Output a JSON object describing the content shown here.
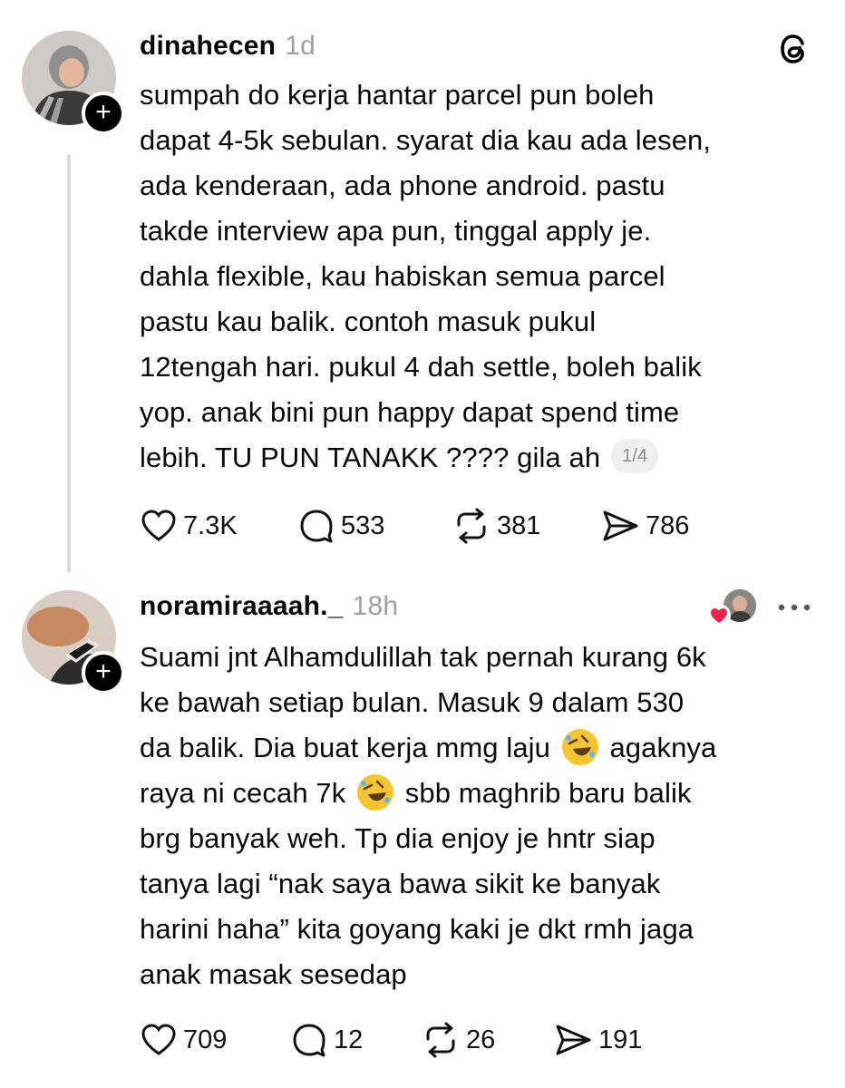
{
  "app": {
    "logo_icon": "threads-logo-icon"
  },
  "posts": [
    {
      "username": "dinahecen",
      "time": "1d",
      "lines": [
        "sumpah do kerja hantar parcel pun boleh",
        "dapat 4-5k sebulan. syarat dia kau ada lesen,",
        "ada kenderaan, ada phone android. pastu",
        "takde interview apa pun, tinggal apply je.",
        "dahla flexible, kau habiskan semua parcel",
        "pastu kau balik. contoh masuk pukul",
        "12tengah hari. pukul 4 dah settle, boleh balik",
        "yop. anak bini pun happy dapat spend time",
        "lebih. TU PUN TANAKK ???? gila ah"
      ],
      "page_indicator": "1/4",
      "likes": "7.3K",
      "replies": "533",
      "reposts": "381",
      "shares": "786"
    },
    {
      "username": "noramiraaaah._",
      "time": "18h",
      "lines": [
        "Suami jnt Alhamdulillah tak pernah kurang 6k",
        "ke bawah setiap bulan. Masuk 9 dalam 530",
        "da balik. Dia buat kerja mmg laju",
        "agaknya",
        "raya ni cecah 7k",
        "sbb maghrib baru balik",
        "brg banyak weh. Tp dia enjoy je hntr siap",
        "tanya lagi “nak saya bawa sikit ke banyak",
        "harini haha” kita goyang kaki je dkt rmh jaga",
        "anak masak sesedap"
      ],
      "emoji": "rolling-on-floor-laughing-emoji",
      "likes": "709",
      "replies": "12",
      "reposts": "26",
      "shares": "191"
    }
  ],
  "colors": {
    "heart_badge": "#e8264b",
    "muted": "#a0a0a0",
    "thread_line": "#dcdcdc"
  }
}
